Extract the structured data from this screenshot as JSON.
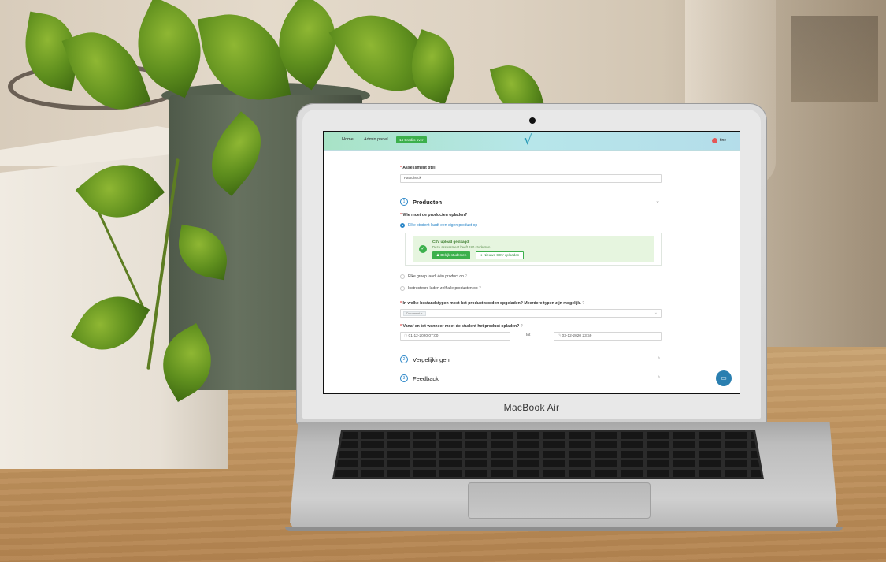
{
  "laptop": {
    "brand_label": "MacBook Air"
  },
  "screen": {
    "nav": {
      "home": "Home",
      "admin_panel": "Admin panel",
      "credits_badge": "14 Credits over"
    },
    "logo_icon": "checkmark-logo-icon",
    "user": {
      "name": "tine",
      "avatar_color": "#e45757"
    },
    "title_field": {
      "label": "Assessment titel",
      "required_mark": "*",
      "value": "Factcheck"
    },
    "section_products": {
      "number": "1",
      "title": "Producten",
      "question_upload": "Wie moet de producten opladen?",
      "options": [
        {
          "label": "Elke student laadt een eigen product op",
          "selected": true
        },
        {
          "label": "Elke groep laadt één product op",
          "selected": false
        },
        {
          "label": "Instructeurs laden zelf alle producten op",
          "selected": false
        }
      ],
      "csv": {
        "title": "CSV upload geslaagd!",
        "description": "Deze assessment heeft 180 studenten.",
        "view_button": "Bekijk studenten",
        "new_button": "Nieuwe CSV uploaden"
      },
      "filetypes_question": "In welke bestandstypen moet het product worden opgeladen? Meerdere typen zijn mogelijk.",
      "filetype_tag": "Document",
      "date_question": "Vanaf en tot wanneer moet de student het product opladen?",
      "date_from": "01-12-2020 07:00",
      "date_sep": "tot",
      "date_to": "03-12-2020 23:59"
    },
    "section_comparisons": {
      "number": "2",
      "title": "Vergelijkingen"
    },
    "section_feedback": {
      "number": "3",
      "title": "Feedback"
    },
    "accent_color": "#2a86c8",
    "success_color": "#3cb04c"
  }
}
